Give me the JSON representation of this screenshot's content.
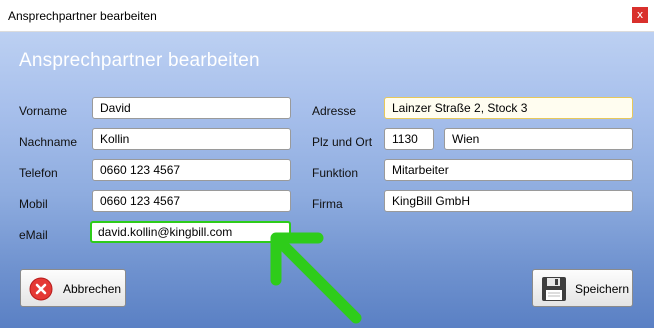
{
  "window": {
    "title": "Ansprechpartner bearbeiten",
    "close_glyph": "x"
  },
  "heading": "Ansprechpartner bearbeiten",
  "left": {
    "vorname": {
      "label": "Vorname",
      "value": "David"
    },
    "nachname": {
      "label": "Nachname",
      "value": "Kollin"
    },
    "telefon": {
      "label": "Telefon",
      "value": "0660 123 4567"
    },
    "mobil": {
      "label": "Mobil",
      "value": "0660 123 4567"
    },
    "email": {
      "label": "eMail",
      "value": "david.kollin@kingbill.com"
    }
  },
  "right": {
    "adresse": {
      "label": "Adresse",
      "value": "Lainzer Straße 2, Stock 3"
    },
    "plzort": {
      "label": "Plz und Ort",
      "plz": "1130",
      "ort": "Wien"
    },
    "funktion": {
      "label": "Funktion",
      "value": "Mitarbeiter"
    },
    "firma": {
      "label": "Firma",
      "value": "KingBill GmbH"
    }
  },
  "buttons": {
    "cancel": {
      "label": "Abbrechen",
      "icon": "cancel-icon"
    },
    "save": {
      "label": "Speichern",
      "icon": "floppy-disk-icon"
    }
  },
  "annotation": {
    "icon": "green-arrow-icon",
    "color": "#2ecc1a"
  },
  "colors": {
    "cancel_icon": "#e53935",
    "focus_border": "#e7c85a"
  }
}
